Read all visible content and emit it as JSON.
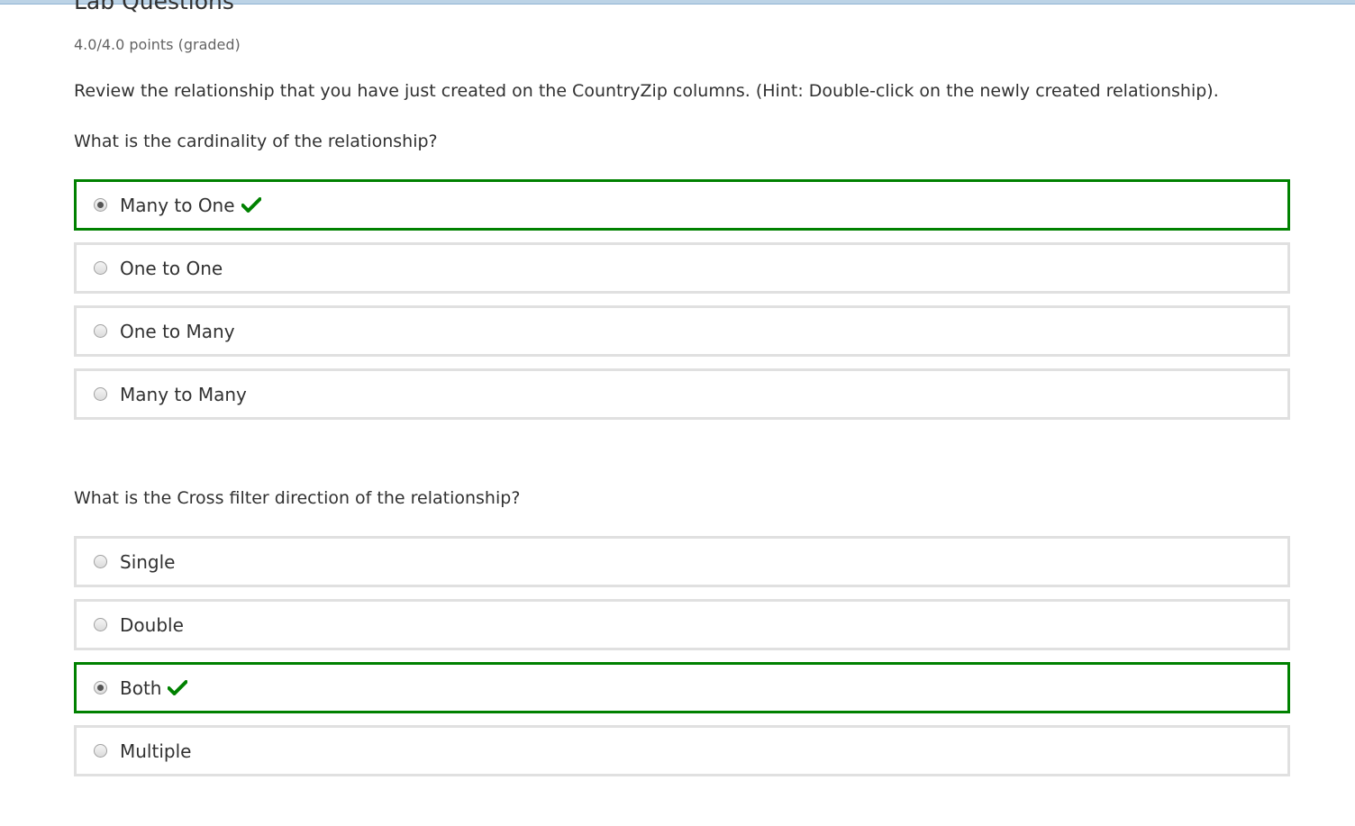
{
  "problem": {
    "title": "Lab Questions",
    "points": "4.0/4.0 points (graded)",
    "instruction": "Review the relationship that you have just created on the CountryZip columns. (Hint: Double-click on the newly created relationship)."
  },
  "questions": [
    {
      "prompt": "What is the cardinality of the relationship?",
      "choices": [
        {
          "label": "Many to One",
          "selected": true,
          "correct": true
        },
        {
          "label": "One to One",
          "selected": false,
          "correct": false
        },
        {
          "label": "One to Many",
          "selected": false,
          "correct": false
        },
        {
          "label": "Many to Many",
          "selected": false,
          "correct": false
        }
      ]
    },
    {
      "prompt": "What is the Cross filter direction of the relationship?",
      "choices": [
        {
          "label": "Single",
          "selected": false,
          "correct": false
        },
        {
          "label": "Double",
          "selected": false,
          "correct": false
        },
        {
          "label": "Both",
          "selected": true,
          "correct": true
        },
        {
          "label": "Multiple",
          "selected": false,
          "correct": false
        }
      ]
    }
  ],
  "colors": {
    "correct_border": "#008100",
    "default_border": "#e0e0e0",
    "text": "#313131",
    "muted_text": "#636363"
  },
  "icons": {
    "correct": "checkmark-icon",
    "radio": "radio-button"
  }
}
